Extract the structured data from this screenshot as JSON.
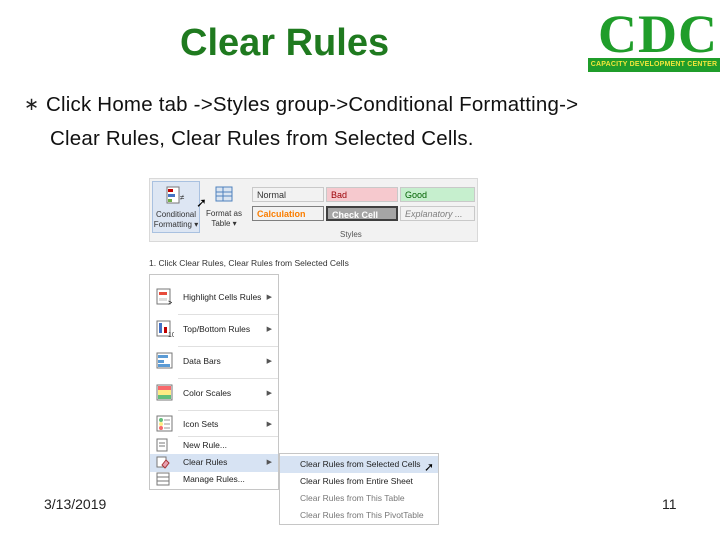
{
  "slide": {
    "title": "Clear Rules",
    "bullet": {
      "line1": "Click Home tab ->Styles group->Conditional Formatting->",
      "line2": "Clear Rules, Clear Rules from Selected Cells."
    },
    "date": "3/13/2019",
    "page_number": "11"
  },
  "logo": {
    "letters": "CDC",
    "tagline": "CAPACITY DEVELOPMENT CENTER",
    "green": "#1f9d2a",
    "yellow": "#f1e63b"
  },
  "ribbon": {
    "conditional_formatting": "Conditional Formatting ▾",
    "format_as_table": "Format as Table ▾",
    "group_label": "Styles",
    "styles": [
      {
        "label": "Normal",
        "bg": "#ffffff",
        "fg": "#000000"
      },
      {
        "label": "Bad",
        "bg": "#f6c9ce",
        "fg": "#9c0006"
      },
      {
        "label": "Good",
        "bg": "#c6efce",
        "fg": "#006100"
      },
      {
        "label": "Calculation",
        "bg": "#f2f2f2",
        "fg": "#fa7d00"
      },
      {
        "label": "Check Cell",
        "bg": "#a5a5a5",
        "fg": "#ffffff"
      },
      {
        "label": "Explanatory ...",
        "bg": "#ffffff",
        "fg": "#7f7f7f"
      }
    ]
  },
  "caption": "1. Click Clear Rules, Clear Rules from Selected Cells",
  "menu": {
    "items": [
      {
        "label": "Highlight Cells Rules",
        "has_arrow": true
      },
      {
        "label": "Top/Bottom Rules",
        "has_arrow": true
      },
      {
        "label": "Data Bars",
        "has_arrow": true
      },
      {
        "label": "Color Scales",
        "has_arrow": true
      },
      {
        "label": "Icon Sets",
        "has_arrow": true
      },
      {
        "label": "New Rule...",
        "has_arrow": false
      },
      {
        "label": "Clear Rules",
        "has_arrow": true
      },
      {
        "label": "Manage Rules...",
        "has_arrow": false
      }
    ],
    "submenu": [
      {
        "label": "Clear Rules from Selected Cells"
      },
      {
        "label": "Clear Rules from Entire Sheet"
      },
      {
        "label": "Clear Rules from This Table"
      },
      {
        "label": "Clear Rules from This PivotTable"
      }
    ]
  }
}
